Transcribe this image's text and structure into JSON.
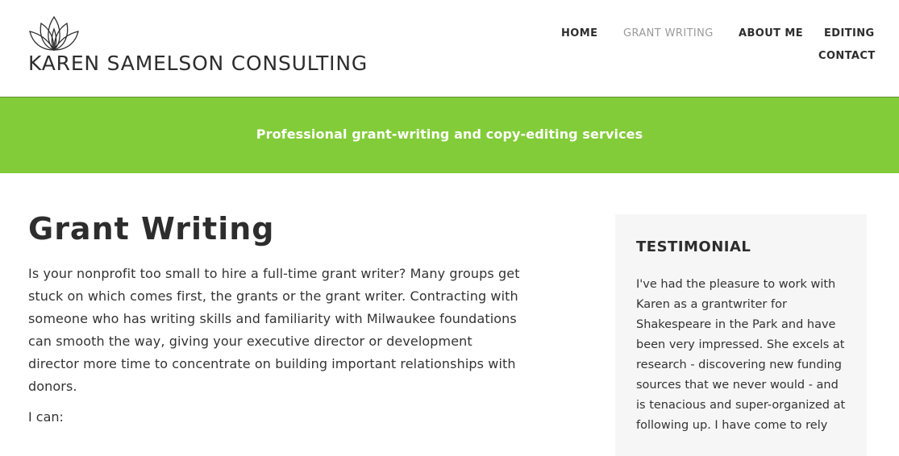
{
  "site": {
    "title": "KAREN SAMELSON CONSULTING"
  },
  "nav": {
    "items": [
      {
        "label": "HOME"
      },
      {
        "label": "GRANT WRITING"
      },
      {
        "label": "ABOUT ME"
      },
      {
        "label": "EDITING"
      },
      {
        "label": "CONTACT"
      }
    ],
    "active_item": "GRANT WRITING"
  },
  "banner": {
    "tagline": "Professional grant-writing and copy-editing services"
  },
  "main": {
    "title": "Grant Writing",
    "intro": "Is your nonprofit too small to hire a full-time grant writer? Many groups get stuck on which comes first, the grants or the grant writer. Contracting with someone who has writing skills and familiarity with Milwaukee foundations can smooth the way, giving your executive director or development director more time to concentrate on building important relationships with donors.",
    "list_intro": "I can:"
  },
  "sidebar": {
    "widget_title": "TESTIMONIAL",
    "testimonial": "I've had the pleasure to work with Karen as a grantwriter for Shakespeare in the Park and have been very impressed. She excels at research - discovering new funding sources that we never would - and is tenacious and super-organized at following up. I have come to rely"
  },
  "colors": {
    "accent_green": "#82cc39",
    "nav_active": "#9a9a9a",
    "sidebar_bg": "#f6f6f6"
  },
  "icons": {
    "logo": "lotus-flower-icon"
  }
}
